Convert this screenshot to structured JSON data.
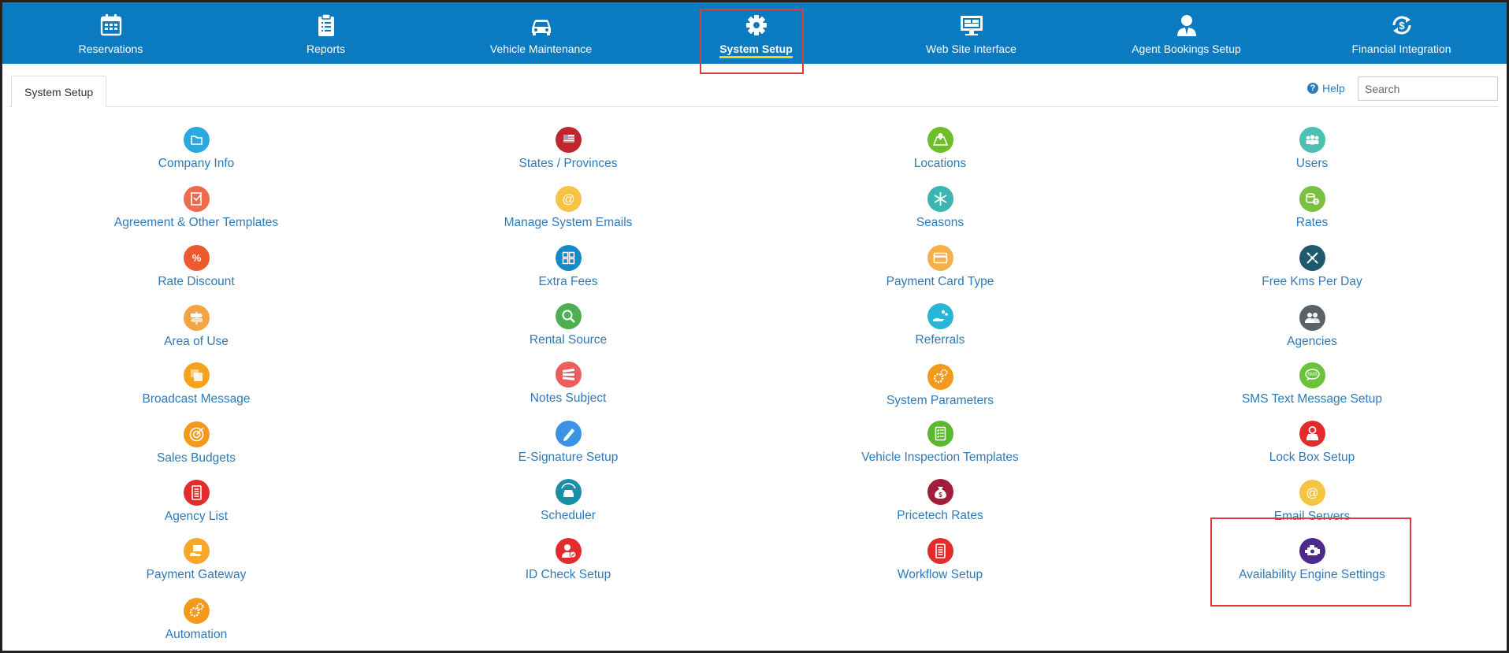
{
  "topnav": {
    "items": [
      {
        "label": "Reservations",
        "icon": "calendar-icon"
      },
      {
        "label": "Reports",
        "icon": "clipboard-icon"
      },
      {
        "label": "Vehicle Maintenance",
        "icon": "car-icon"
      },
      {
        "label": "System Setup",
        "icon": "gear-icon",
        "active": true
      },
      {
        "label": "Web Site Interface",
        "icon": "monitor-icon"
      },
      {
        "label": "Agent Bookings Setup",
        "icon": "agent-icon"
      },
      {
        "label": "Financial Integration",
        "icon": "dollar-sync-icon"
      }
    ],
    "bg_color": "#0a7bc1",
    "active_underline_color": "#ffd400"
  },
  "tab": {
    "label": "System Setup"
  },
  "help": {
    "label": "Help"
  },
  "search": {
    "placeholder": "Search"
  },
  "grid": {
    "columns": [
      {
        "items": [
          {
            "label": "Company Info",
            "icon": "folder-icon",
            "color": "#29a9e0"
          },
          {
            "label": "Agreement & Other Templates",
            "icon": "document-edit-icon",
            "color": "#ee6a4d"
          },
          {
            "label": "Rate Discount",
            "icon": "percent-icon",
            "color": "#ee5a30"
          },
          {
            "label": "Area of Use",
            "icon": "signpost-icon",
            "color": "#f5a443"
          },
          {
            "label": "Broadcast Message",
            "icon": "stacked-squares-icon",
            "color": "#f7a21b"
          },
          {
            "label": "Sales Budgets",
            "icon": "target-icon",
            "color": "#f39a1d"
          },
          {
            "label": "Agency List",
            "icon": "list-icon",
            "color": "#e32b2b"
          },
          {
            "label": "Payment Gateway",
            "icon": "payment-hand-icon",
            "color": "#f7a72a"
          },
          {
            "label": "Automation",
            "icon": "gears-icon",
            "color": "#f39a1d"
          }
        ]
      },
      {
        "items": [
          {
            "label": "States / Provinces",
            "icon": "flag-icon",
            "color": "#c0262d"
          },
          {
            "label": "Manage System Emails",
            "icon": "at-sign-icon",
            "color": "#f6c445"
          },
          {
            "label": "Extra Fees",
            "icon": "calculator-icon",
            "color": "#1689c8"
          },
          {
            "label": "Rental Source",
            "icon": "magnifier-icon",
            "color": "#4caf50"
          },
          {
            "label": "Notes Subject",
            "icon": "notes-stack-icon",
            "color": "#ee5d5d"
          },
          {
            "label": "E-Signature Setup",
            "icon": "pen-icon",
            "color": "#3b94e3"
          },
          {
            "label": "Scheduler",
            "icon": "car-sync-icon",
            "color": "#1a8fa8"
          },
          {
            "label": "ID Check Setup",
            "icon": "user-check-icon",
            "color": "#e32b2b"
          }
        ]
      },
      {
        "items": [
          {
            "label": "Locations",
            "icon": "map-icon",
            "color": "#6cbf2a"
          },
          {
            "label": "Seasons",
            "icon": "snowflake-icon",
            "color": "#3db5b5"
          },
          {
            "label": "Payment Card Type",
            "icon": "card-icon",
            "color": "#f5b04b"
          },
          {
            "label": "Referrals",
            "icon": "hand-coins-icon",
            "color": "#29b6d6"
          },
          {
            "label": "System Parameters",
            "icon": "gears-icon",
            "color": "#f39a1d"
          },
          {
            "label": "Vehicle Inspection Templates",
            "icon": "checklist-icon",
            "color": "#5cb82e"
          },
          {
            "label": "Pricetech Rates",
            "icon": "money-bag-icon",
            "color": "#a11d3a"
          },
          {
            "label": "Workflow Setup",
            "icon": "list-icon",
            "color": "#e32b2b"
          }
        ]
      },
      {
        "items": [
          {
            "label": "Users",
            "icon": "users-icon",
            "color": "#4cc1b3"
          },
          {
            "label": "Rates",
            "icon": "coins-icon",
            "color": "#7bc043"
          },
          {
            "label": "Free Kms Per Day",
            "icon": "road-cross-icon",
            "color": "#1d5a6e"
          },
          {
            "label": "Agencies",
            "icon": "agencies-icon",
            "color": "#5a6268"
          },
          {
            "label": "SMS Text Message Setup",
            "icon": "sms-icon",
            "color": "#6ac23b"
          },
          {
            "label": "Lock Box Setup",
            "icon": "car-lock-icon",
            "color": "#e32b2b"
          },
          {
            "label": "Email Servers",
            "icon": "at-sign-icon",
            "color": "#f6c445"
          },
          {
            "label": "Availability Engine Settings",
            "icon": "engine-icon",
            "color": "#4b2a8c"
          }
        ]
      }
    ]
  }
}
